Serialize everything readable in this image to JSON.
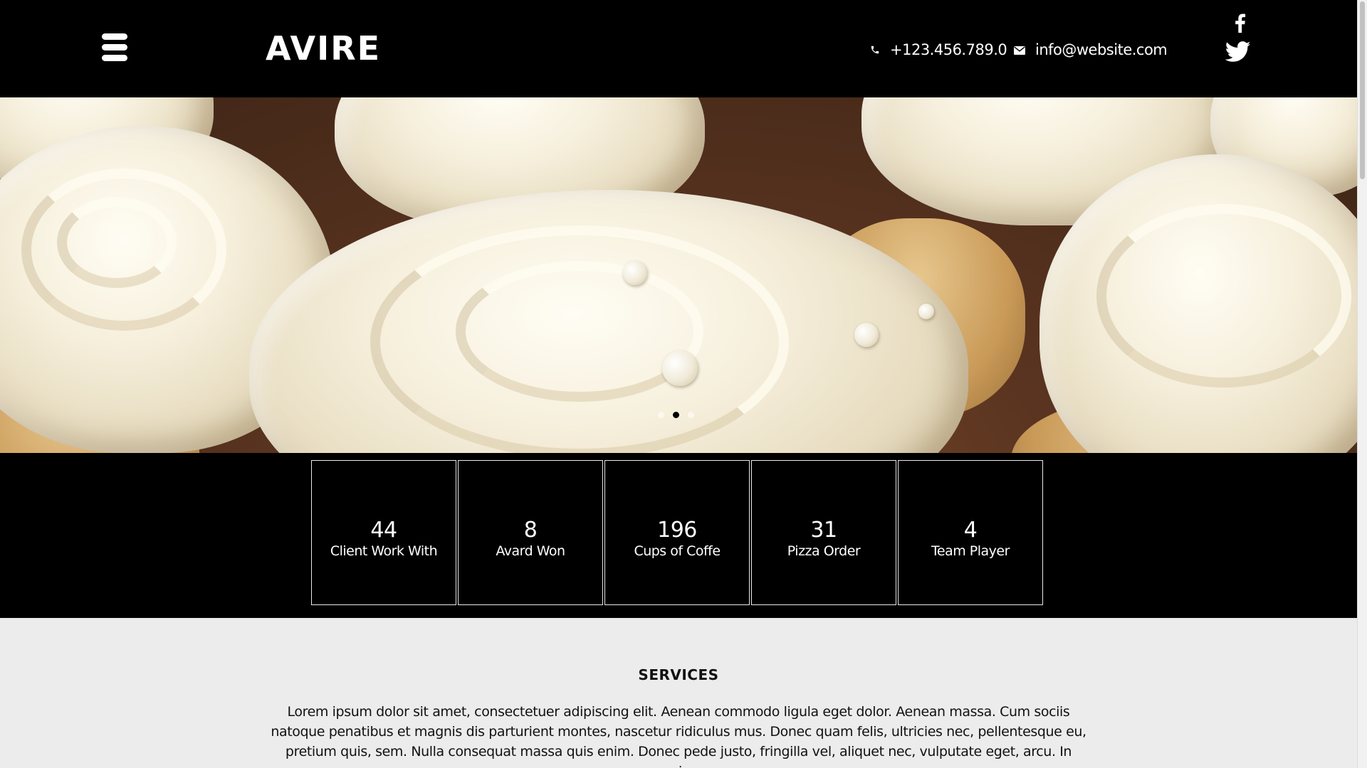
{
  "header": {
    "logo": "AVIRE",
    "phone": "+123.456.789.0",
    "email": "info@website.com",
    "menu_icon": "hamburger-menu-icon",
    "phone_icon": "phone-icon",
    "email_icon": "envelope-icon",
    "social": [
      "facebook-icon",
      "twitter-icon"
    ]
  },
  "hero": {
    "slide_count": 3,
    "active_slide": 2
  },
  "stats": [
    {
      "number": "44",
      "label": "Client Work With"
    },
    {
      "number": "8",
      "label": "Avard Won"
    },
    {
      "number": "196",
      "label": "Cups of Coffe"
    },
    {
      "number": "31",
      "label": "Pizza Order"
    },
    {
      "number": "4",
      "label": "Team Player"
    }
  ],
  "services": {
    "title": "SERVICES",
    "text_lines": [
      "Lorem ipsum dolor sit amet, consectetuer adipiscing elit. Aenean commodo ligula eget dolor. Aenean massa. Cum sociis",
      "natoque penatibus et magnis dis parturient montes, nascetur ridiculus mus. Donec quam felis, ultricies nec, pellentesque eu,",
      "pretium quis, sem. Nulla consequat massa quis enim. Donec pede justo, fringilla vel, aliquet nec, vulputate eget, arcu. In enim"
    ]
  },
  "colors": {
    "header_bg": "#000000",
    "services_bg": "#ececec",
    "text_light": "#ffffff",
    "text_dark": "#111111"
  }
}
